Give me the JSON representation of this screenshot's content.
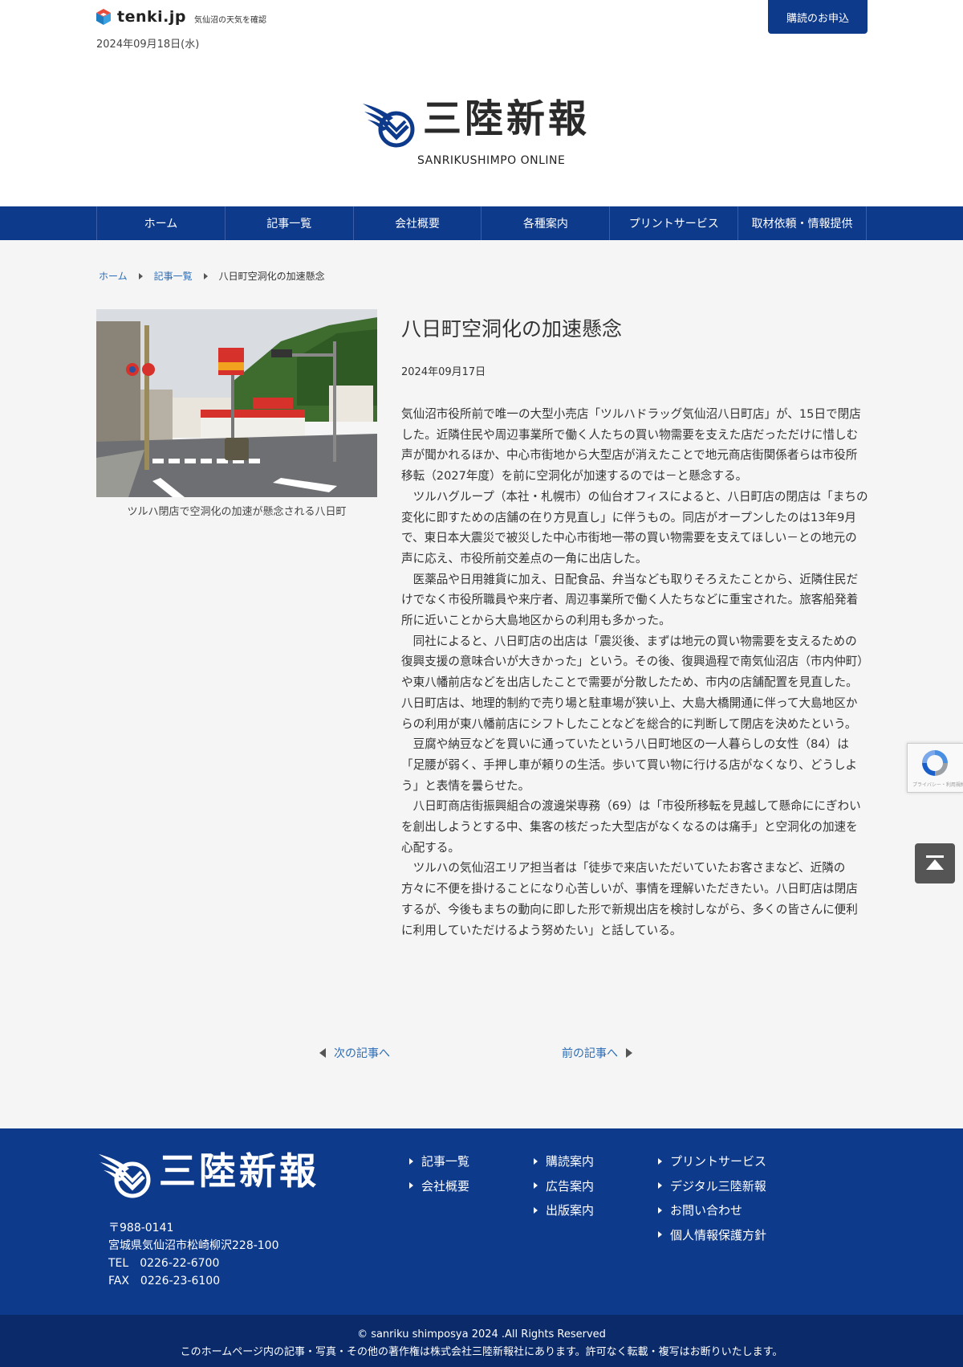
{
  "header": {
    "tenki_logo": "tenki.jp",
    "tenki_sub": "気仙沼の天気を確認",
    "date": "2024年09月18日(水)",
    "subscribe_label": "購読のお申込",
    "mast_title": "三陸新報",
    "mast_roman": "SANRIKUSHIMPO ONLINE"
  },
  "nav": {
    "items": [
      "ホーム",
      "記事一覧",
      "会社概要",
      "各種案内",
      "プリントサービス",
      "取材依頼・情報提供"
    ]
  },
  "breadcrumb": {
    "home": "ホーム",
    "list": "記事一覧",
    "current": "八日町空洞化の加速懸念"
  },
  "article": {
    "caption": "ツルハ閉店で空洞化の加速が懸念される八日町",
    "title": "八日町空洞化の加速懸念",
    "date": "2024年09月17日",
    "paragraphs": [
      "気仙沼市役所前で唯一の大型小売店「ツルハドラッグ気仙沼八日町店」が、15日で閉店した。近隣住民や周辺事業所で働く人たちの買い物需要を支えた店だっただけに惜しむ声が聞かれるほか、中心市街地から大型店が消えたことで地元商店街関係者らは市役所移転（2027年度）を前に空洞化が加速するのでは－と懸念する。",
      "　ツルハグループ（本社・札幌市）の仙台オフィスによると、八日町店の閉店は「まちの変化に即すための店舗の在り方見直し」に伴うもの。同店がオープンしたのは13年9月で、東日本大震災で被災した中心市街地一帯の買い物需要を支えてほしい－との地元の声に応え、市役所前交差点の一角に出店した。",
      "　医薬品や日用雑貨に加え、日配食品、弁当なども取りそろえたことから、近隣住民だけでなく市役所職員や来庁者、周辺事業所で働く人たちなどに重宝された。旅客船発着所に近いことから大島地区からの利用も多かった。",
      "　同社によると、八日町店の出店は「震災後、まずは地元の買い物需要を支えるための復興支援の意味合いが大きかった」という。その後、復興過程で南気仙沼店（市内仲町）や東八幡前店などを出店したことで需要が分散したため、市内の店舗配置を見直した。",
      "八日町店は、地理的制約で売り場と駐車場が狭い上、大島大橋開通に伴って大島地区からの利用が東八幡前店にシフトしたことなどを総合的に判断して閉店を決めたという。",
      "　豆腐や納豆などを買いに通っていたという八日町地区の一人暮らしの女性（84）は「足腰が弱く、手押し車が頼りの生活。歩いて買い物に行ける店がなくなり、どうしよう」と表情を曇らせた。",
      "　八日町商店街振興組合の渡邊栄専務（69）は「市役所移転を見越して懸命ににぎわいを創出しようとする中、集客の核だった大型店がなくなるのは痛手」と空洞化の加速を心配する。",
      "　ツルハの気仙沼エリア担当者は「徒歩で来店いただいていたお客さまなど、近隣の方々に不便を掛けることになり心苦しいが、事情を理解いただきたい。八日町店は閉店するが、今後もまちの動向に即した形で新規出店を検討しながら、多くの皆さんに便利に利用していただけるよう努めたい」と話している。"
    ],
    "next_label": "次の記事へ",
    "prev_label": "前の記事へ"
  },
  "widgets": {
    "recaptcha_sub": "プライバシー・利用規約"
  },
  "footer": {
    "title": "三陸新報",
    "address": [
      "〒988-0141",
      "宮城県気仙沼市松崎柳沢228-100",
      "TEL　0226-22-6700",
      "FAX　0226-23-6100"
    ],
    "col1": [
      "記事一覧",
      "会社概要"
    ],
    "col2": [
      "購読案内",
      "広告案内",
      "出版案内"
    ],
    "col3": [
      "プリントサービス",
      "デジタル三陸新報",
      "お問い合わせ",
      "個人情報保護方針"
    ],
    "copyright": "© sanriku shimposya 2024 .All Rights Reserved",
    "notice": "このホームページ内の記事・写真・その他の著作権は株式会社三陸新報社にあります。許可なく転載・複写はお断りいたします。"
  },
  "colors": {
    "brand_blue": "#0e3a8c",
    "link_blue": "#2b6cb6"
  }
}
